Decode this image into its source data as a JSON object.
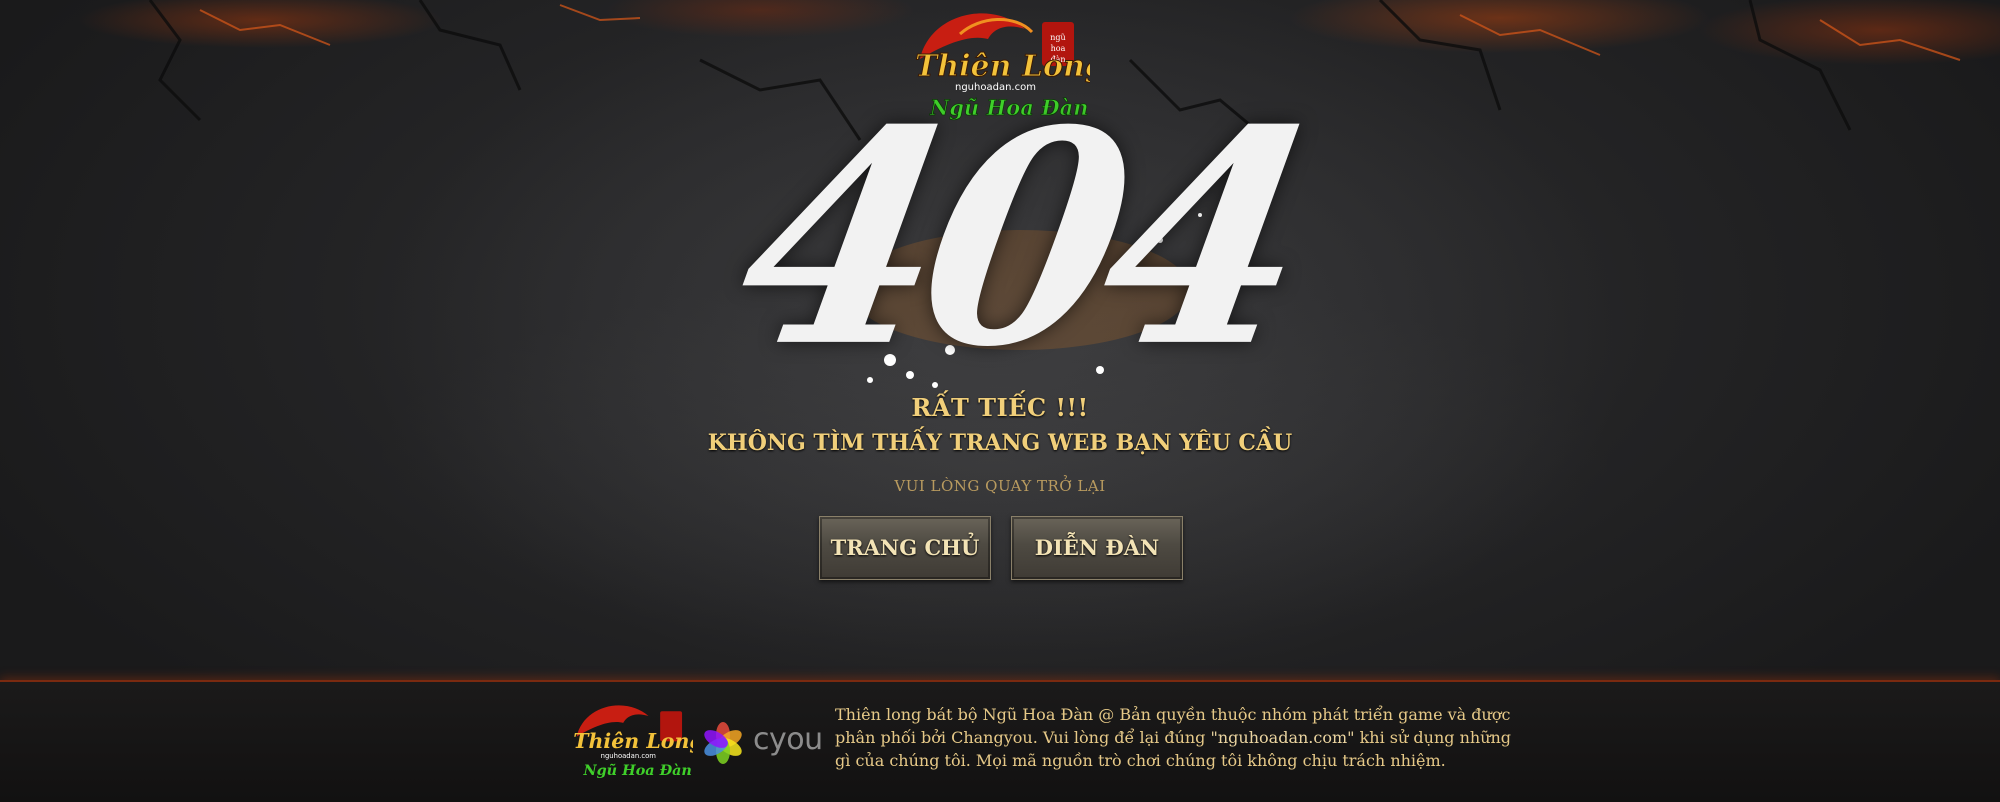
{
  "logo": {
    "title_top": "Thiên Long",
    "domain": "nguhoadan.com",
    "title_bottom": "Ngũ Hoa Đàn",
    "seal": "ngũ hoa đàn"
  },
  "error": {
    "code": "404",
    "headline": "RẤT TIẾC !!!",
    "message": "KHÔNG TÌM THẤY TRANG WEB BẠN YÊU CẦU",
    "hint": "VUI LÒNG QUAY TRỞ LẠI"
  },
  "buttons": {
    "home": "TRANG CHỦ",
    "forum": "DIỄN ĐÀN"
  },
  "footer": {
    "partner_name": "cyou",
    "copyright_line1": "Thiên long bát bộ Ngũ Hoa Đàn @ Bản quyền thuộc nhóm phát triển game và được",
    "copyright_line2_a": "phân phối bởi Changyou. Vui lòng để lại đúng",
    "copyright_domain": "\"nguhoadan.com\"",
    "copyright_line2_b": "khi sử dụng những",
    "copyright_line3": "gì của chúng tôi. Mọi mã nguồn trò chơi chúng tôi không chịu trách nhiệm."
  },
  "colors": {
    "accent_gold": "#f1cf7a",
    "lava": "#c8460a",
    "background": "#1e1e1f"
  }
}
